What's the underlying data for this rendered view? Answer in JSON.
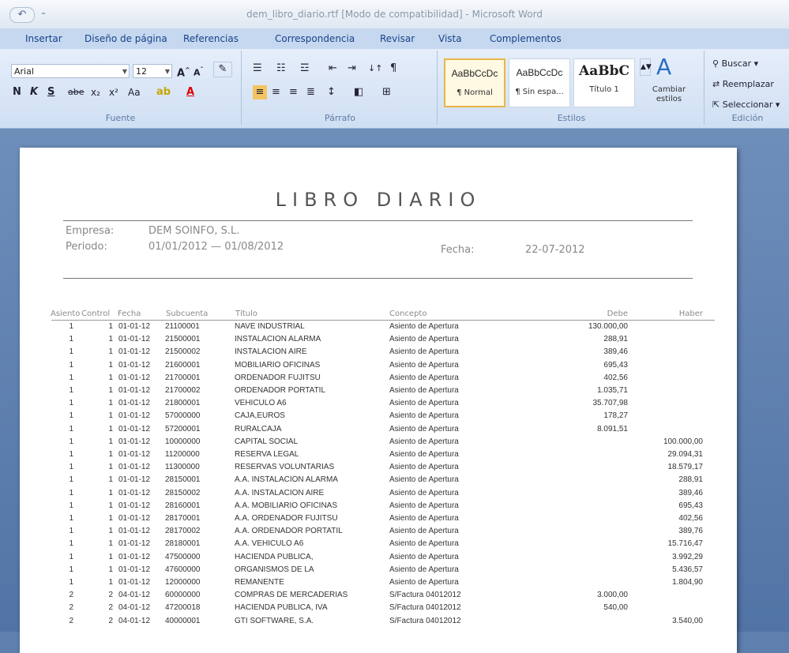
{
  "window": {
    "title": "dem_libro_diario.rtf [Modo de compatibilidad] - Microsoft Word",
    "qat_undo": "↶",
    "qat_more": "⁼"
  },
  "tabs": [
    "Insertar",
    "Diseño de página",
    "Referencias",
    "Correspondencia",
    "Revisar",
    "Vista",
    "Complementos"
  ],
  "ribbon": {
    "font": {
      "name": "Arial",
      "size": "12",
      "label": "Fuente"
    },
    "paragraph": {
      "label": "Párrafo"
    },
    "styles": {
      "label": "Estilos",
      "items": [
        {
          "preview": "AaBbCcDc",
          "name": "¶ Normal"
        },
        {
          "preview": "AaBbCcDc",
          "name": "¶ Sin espa..."
        },
        {
          "preview": "AaBbC",
          "name": "Título 1"
        }
      ],
      "change_styles": "Cambiar estilos"
    },
    "editing": {
      "label": "Edición",
      "find": "Buscar",
      "replace": "Reemplazar",
      "select": "Seleccionar"
    }
  },
  "document": {
    "title": "LIBRO DIARIO",
    "empresa_label": "Empresa:",
    "empresa_value": "DEM SOINFO, S.L.",
    "periodo_label": "Periodo:",
    "periodo_value": "01/01/2012 — 01/08/2012",
    "fecha_label": "Fecha:",
    "fecha_value": "22-07-2012",
    "columns": [
      "Asiento",
      "Control",
      "Fecha",
      "Subcuenta",
      "Título",
      "Concepto",
      "Debe",
      "Haber"
    ],
    "rows": [
      [
        "1",
        "1",
        "01-01-12",
        "21100001",
        "NAVE INDUSTRIAL",
        "Asiento de Apertura",
        "130.000,00",
        ""
      ],
      [
        "1",
        "1",
        "01-01-12",
        "21500001",
        "INSTALACION ALARMA",
        "Asiento de Apertura",
        "288,91",
        ""
      ],
      [
        "1",
        "1",
        "01-01-12",
        "21500002",
        "INSTALACION AIRE",
        "Asiento de Apertura",
        "389,46",
        ""
      ],
      [
        "1",
        "1",
        "01-01-12",
        "21600001",
        "MOBILIARIO OFICINAS",
        "Asiento de Apertura",
        "695,43",
        ""
      ],
      [
        "1",
        "1",
        "01-01-12",
        "21700001",
        "ORDENADOR FUJITSU",
        "Asiento de Apertura",
        "402,56",
        ""
      ],
      [
        "1",
        "1",
        "01-01-12",
        "21700002",
        "ORDENADOR PORTATIL",
        "Asiento de Apertura",
        "1.035,71",
        ""
      ],
      [
        "1",
        "1",
        "01-01-12",
        "21800001",
        "VEHICULO A6",
        "Asiento de Apertura",
        "35.707,98",
        ""
      ],
      [
        "1",
        "1",
        "01-01-12",
        "57000000",
        "CAJA,EUROS",
        "Asiento de Apertura",
        "178,27",
        ""
      ],
      [
        "1",
        "1",
        "01-01-12",
        "57200001",
        "RURALCAJA",
        "Asiento de Apertura",
        "8.091,51",
        ""
      ],
      [
        "1",
        "1",
        "01-01-12",
        "10000000",
        "CAPITAL SOCIAL",
        "Asiento de Apertura",
        "",
        "100.000,00"
      ],
      [
        "1",
        "1",
        "01-01-12",
        "11200000",
        "RESERVA LEGAL",
        "Asiento de Apertura",
        "",
        "29.094,31"
      ],
      [
        "1",
        "1",
        "01-01-12",
        "11300000",
        "RESERVAS VOLUNTARIAS",
        "Asiento de Apertura",
        "",
        "18.579,17"
      ],
      [
        "1",
        "1",
        "01-01-12",
        "28150001",
        "A.A. INSTALACION ALARMA",
        "Asiento de Apertura",
        "",
        "288,91"
      ],
      [
        "1",
        "1",
        "01-01-12",
        "28150002",
        "A.A. INSTALACION AIRE",
        "Asiento de Apertura",
        "",
        "389,46"
      ],
      [
        "1",
        "1",
        "01-01-12",
        "28160001",
        "A.A. MOBILIARIO OFICINAS",
        "Asiento de Apertura",
        "",
        "695,43"
      ],
      [
        "1",
        "1",
        "01-01-12",
        "28170001",
        "A.A. ORDENADOR FUJITSU",
        "Asiento de Apertura",
        "",
        "402,56"
      ],
      [
        "1",
        "1",
        "01-01-12",
        "28170002",
        "A.A. ORDENADOR PORTATIL",
        "Asiento de Apertura",
        "",
        "389,76"
      ],
      [
        "1",
        "1",
        "01-01-12",
        "28180001",
        "A.A. VEHICULO A6",
        "Asiento de Apertura",
        "",
        "15.716,47"
      ],
      [
        "1",
        "1",
        "01-01-12",
        "47500000",
        "HACIENDA PUBLICA,",
        "Asiento de Apertura",
        "",
        "3.992,29"
      ],
      [
        "1",
        "1",
        "01-01-12",
        "47600000",
        "ORGANISMOS DE LA",
        "Asiento de Apertura",
        "",
        "5.436,57"
      ],
      [
        "1",
        "1",
        "01-01-12",
        "12000000",
        "REMANENTE",
        "Asiento de Apertura",
        "",
        "1.804,90"
      ],
      [
        "2",
        "2",
        "04-01-12",
        "60000000",
        "COMPRAS DE MERCADERIAS",
        "S/Factura 04012012",
        "3.000,00",
        ""
      ],
      [
        "2",
        "2",
        "04-01-12",
        "47200018",
        "HACIENDA PUBLICA, IVA",
        "S/Factura 04012012",
        "540,00",
        ""
      ],
      [
        "2",
        "2",
        "04-01-12",
        "40000001",
        "GTI SOFTWARE, S.A.",
        "S/Factura 04012012",
        "",
        "3.540,00"
      ]
    ]
  }
}
